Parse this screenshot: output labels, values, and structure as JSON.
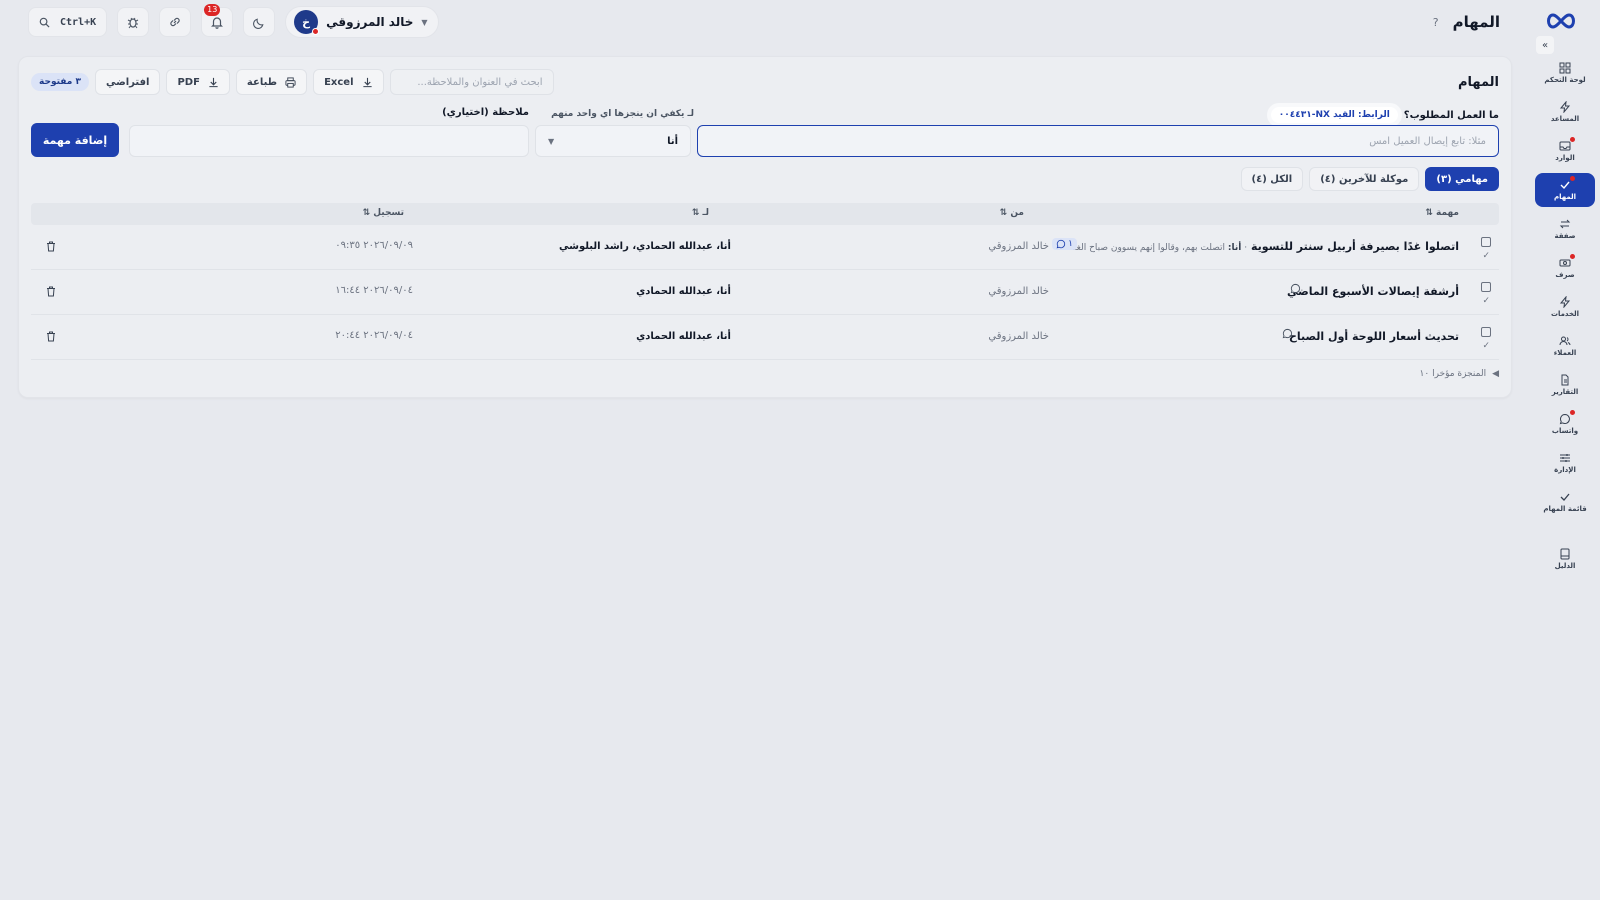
{
  "topbar": {
    "title": "المهام",
    "help_icon": "?",
    "search_shortcut": "Ctrl+K",
    "notifications_count": "13",
    "user": {
      "name": "خالد المرزوقي",
      "initial": "خ"
    }
  },
  "sidebar": {
    "items": [
      {
        "label": "لوحة التحكم",
        "icon": "dashboard-icon"
      },
      {
        "label": "المساعد",
        "icon": "bolt-icon"
      },
      {
        "label": "الوارد",
        "icon": "inbox-icon"
      },
      {
        "label": "المهام",
        "icon": "tasks-icon"
      },
      {
        "label": "صفقة",
        "icon": "transfer-icon"
      },
      {
        "label": "صرف",
        "icon": "money-icon"
      },
      {
        "label": "الخدمات",
        "icon": "services-icon"
      },
      {
        "label": "العملاء",
        "icon": "clients-icon"
      },
      {
        "label": "التقارير",
        "icon": "reports-icon"
      },
      {
        "label": "واتساب",
        "icon": "chat-icon"
      },
      {
        "label": "الإدارة",
        "icon": "sliders-icon"
      },
      {
        "label": "قائمة المهام",
        "icon": "check-icon"
      },
      {
        "label": "الدليل",
        "icon": "book-icon"
      }
    ]
  },
  "card": {
    "title": "المهام",
    "search_placeholder": "ابحث في العنوان والملاحظة...",
    "excel_label": "Excel",
    "print_label": "طباعة",
    "pdf_label": "PDF",
    "default_label": "افتراضي",
    "open_badge": "٣ مفتوحة"
  },
  "form": {
    "what_label": "ما العمل المطلوب؟",
    "link_chip": "الرابط: القيد NX-٠٠٤٤٣١",
    "to_label": "لـ يكفي ان ينجزها اي واحد منهم",
    "note_label": "ملاحظة (اختياري)",
    "task_placeholder": "مثلا: تابع إيصال العميل امس",
    "assignee_value": "أنا",
    "add_button": "إضافة مهمة"
  },
  "tabs": [
    {
      "label": "مهامي (٣)",
      "active": true
    },
    {
      "label": "موكلة للآخرين (٤)",
      "active": false
    },
    {
      "label": "الكل (٤)",
      "active": false
    }
  ],
  "table": {
    "headers": {
      "task": "مهمة ⇅",
      "from": "من ⇅",
      "to": "لـ ⇅",
      "logged": "تسجيل ⇅"
    },
    "rows": [
      {
        "title": "اتصلوا غدًا بصيرفة أربيل سنتر للتسوية",
        "note_prefix": "أنا:",
        "note": "اتصلت بهم، وقالوا إنهم يسوون صباح الغد.",
        "comments": "١",
        "from": "خالد المرزوقي",
        "to": "أنا، عبدالله الحمادي، راشد البلوشي",
        "date": "٢٠٢٦/٠٩/٠٩ ٠٩:٣٥"
      },
      {
        "title": "أرشفة إيصالات الأسبوع الماضي",
        "from": "خالد المرزوقي",
        "to": "أنا، عبدالله الحمادي",
        "date": "٢٠٢٦/٠٩/٠٤ ١٦:٤٤"
      },
      {
        "title": "تحديث أسعار اللوحة أول الصباح",
        "from": "خالد المرزوقي",
        "to": "أنا، عبدالله الحمادي",
        "date": "٢٠٢٦/٠٩/٠٤ ٢٠:٤٤"
      }
    ]
  },
  "recent_done": "المنجزة مؤخرا ١٠"
}
